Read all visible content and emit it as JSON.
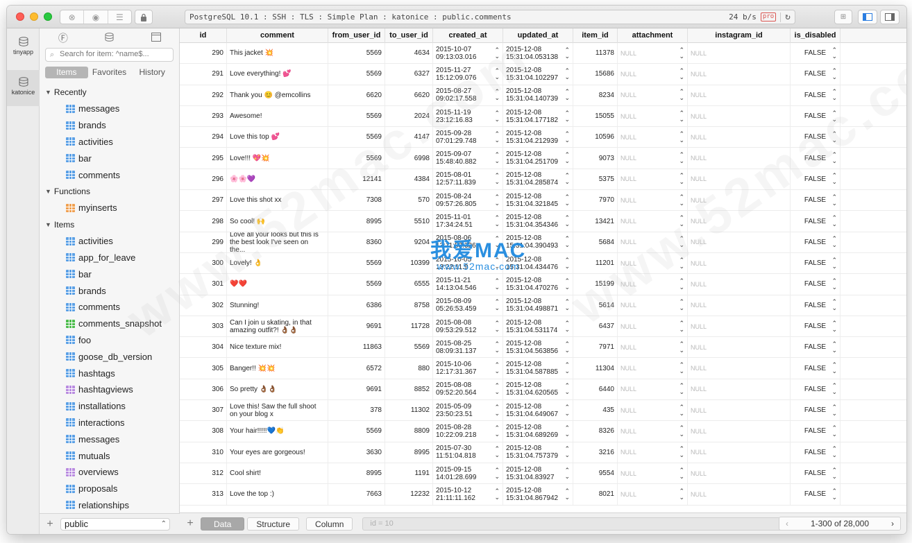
{
  "titlebar": {
    "connection": "PostgreSQL 10.1 : SSH : TLS : Simple Plan : katonice : public.comments",
    "throughput": "24 b/s",
    "pro_badge": "pro"
  },
  "rail": {
    "items": [
      "tinyapp",
      "katonice"
    ]
  },
  "sidebar": {
    "search_placeholder": "Search for item: ^name$...",
    "segments": [
      "Items",
      "Favorites",
      "History"
    ],
    "sections": [
      {
        "title": "Recently",
        "items": [
          {
            "label": "messages",
            "icon": "table-icon"
          },
          {
            "label": "brands",
            "icon": "table-icon"
          },
          {
            "label": "activities",
            "icon": "table-icon"
          },
          {
            "label": "bar",
            "icon": "table-icon"
          },
          {
            "label": "comments",
            "icon": "table-icon"
          }
        ]
      },
      {
        "title": "Functions",
        "items": [
          {
            "label": "myinserts",
            "icon": "function-icon"
          }
        ]
      },
      {
        "title": "Items",
        "items": [
          {
            "label": "activities",
            "icon": "table-icon"
          },
          {
            "label": "app_for_leave",
            "icon": "table-icon"
          },
          {
            "label": "bar",
            "icon": "table-icon"
          },
          {
            "label": "brands",
            "icon": "table-icon"
          },
          {
            "label": "comments",
            "icon": "table-icon"
          },
          {
            "label": "comments_snapshot",
            "icon": "materialized-view-icon"
          },
          {
            "label": "foo",
            "icon": "table-icon"
          },
          {
            "label": "goose_db_version",
            "icon": "table-icon"
          },
          {
            "label": "hashtags",
            "icon": "table-icon"
          },
          {
            "label": "hashtagviews",
            "icon": "view-icon"
          },
          {
            "label": "installations",
            "icon": "table-icon"
          },
          {
            "label": "interactions",
            "icon": "table-icon"
          },
          {
            "label": "messages",
            "icon": "table-icon"
          },
          {
            "label": "mutuals",
            "icon": "table-icon"
          },
          {
            "label": "overviews",
            "icon": "view-icon"
          },
          {
            "label": "proposals",
            "icon": "table-icon"
          },
          {
            "label": "relationships",
            "icon": "table-icon"
          }
        ]
      }
    ],
    "schema": "public"
  },
  "grid": {
    "columns": [
      "id",
      "comment",
      "from_user_id",
      "to_user_id",
      "created_at",
      "updated_at",
      "item_id",
      "attachment",
      "instagram_id",
      "is_disabled"
    ],
    "null_text": "NULL",
    "rows": [
      {
        "id": "290",
        "comment": "This jacket 💥",
        "from": "5569",
        "to": "4634",
        "created": "2015-10-07\n09:13:03.016",
        "updated": "2015-12-08\n15:31:04.053138",
        "item": "11378",
        "disabled": "FALSE"
      },
      {
        "id": "291",
        "comment": "Love everything! 💕",
        "from": "5569",
        "to": "6327",
        "created": "2015-11-27\n15:12:09.076",
        "updated": "2015-12-08\n15:31:04.102297",
        "item": "15686",
        "disabled": "FALSE"
      },
      {
        "id": "292",
        "comment": "Thank you 😊 @emcollins",
        "from": "6620",
        "to": "6620",
        "created": "2015-08-27\n09:02:17.558",
        "updated": "2015-12-08\n15:31:04.140739",
        "item": "8234",
        "disabled": "FALSE"
      },
      {
        "id": "293",
        "comment": "Awesome!",
        "from": "5569",
        "to": "2024",
        "created": "2015-11-19\n23:12:16.83",
        "updated": "2015-12-08\n15:31:04.177182",
        "item": "15055",
        "disabled": "FALSE"
      },
      {
        "id": "294",
        "comment": "Love this top 💕",
        "from": "5569",
        "to": "4147",
        "created": "2015-09-28\n07:01:29.748",
        "updated": "2015-12-08\n15:31:04.212939",
        "item": "10596",
        "disabled": "FALSE"
      },
      {
        "id": "295",
        "comment": "Love!!! 💖💥",
        "from": "5569",
        "to": "6998",
        "created": "2015-09-07\n15:48:40.882",
        "updated": "2015-12-08\n15:31:04.251709",
        "item": "9073",
        "disabled": "FALSE"
      },
      {
        "id": "296",
        "comment": "🌸🌸💜",
        "from": "12141",
        "to": "4384",
        "created": "2015-08-01\n12:57:11.839",
        "updated": "2015-12-08\n15:31:04.285874",
        "item": "5375",
        "disabled": "FALSE"
      },
      {
        "id": "297",
        "comment": "Love this shot xx",
        "from": "7308",
        "to": "570",
        "created": "2015-08-24\n09:57:26.805",
        "updated": "2015-12-08\n15:31:04.321845",
        "item": "7970",
        "disabled": "FALSE"
      },
      {
        "id": "298",
        "comment": "So cool! 🙌",
        "from": "8995",
        "to": "5510",
        "created": "2015-11-01\n17:34:24.51",
        "updated": "2015-12-08\n15:31:04.354346",
        "item": "13421",
        "disabled": "FALSE"
      },
      {
        "id": "299",
        "comment": "Love all your looks but this is the best look I've seen on the...",
        "from": "8360",
        "to": "9204",
        "created": "2015-08-06\n13:11:53.326",
        "updated": "2015-12-08\n15:31:04.390493",
        "item": "5684",
        "disabled": "FALSE"
      },
      {
        "id": "300",
        "comment": "Lovely! 👌",
        "from": "5569",
        "to": "10399",
        "created": "2015-10-05\n13:22:11.9",
        "updated": "2015-12-08\n15:31:04.434476",
        "item": "11201",
        "disabled": "FALSE"
      },
      {
        "id": "301",
        "comment": "❤️❤️",
        "from": "5569",
        "to": "6555",
        "created": "2015-11-21\n14:13:04.546",
        "updated": "2015-12-08\n15:31:04.470276",
        "item": "15199",
        "disabled": "FALSE"
      },
      {
        "id": "302",
        "comment": "Stunning!",
        "from": "6386",
        "to": "8758",
        "created": "2015-08-09\n05:26:53.459",
        "updated": "2015-12-08\n15:31:04.498871",
        "item": "5614",
        "disabled": "FALSE"
      },
      {
        "id": "303",
        "comment": "Can I join u skating, in that amazing outfit?! 👌🏾👌🏾",
        "from": "9691",
        "to": "11728",
        "created": "2015-08-08\n09:53:29.512",
        "updated": "2015-12-08\n15:31:04.531174",
        "item": "6437",
        "disabled": "FALSE"
      },
      {
        "id": "304",
        "comment": "Nice texture mix!",
        "from": "11863",
        "to": "5569",
        "created": "2015-08-25\n08:09:31.137",
        "updated": "2015-12-08\n15:31:04.563856",
        "item": "7971",
        "disabled": "FALSE"
      },
      {
        "id": "305",
        "comment": "Banger!! 💥💥",
        "from": "6572",
        "to": "880",
        "created": "2015-10-06\n12:17:31.367",
        "updated": "2015-12-08\n15:31:04.587885",
        "item": "11304",
        "disabled": "FALSE"
      },
      {
        "id": "306",
        "comment": "So pretty 👌🏾👌🏾",
        "from": "9691",
        "to": "8852",
        "created": "2015-08-08\n09:52:20.564",
        "updated": "2015-12-08\n15:31:04.620565",
        "item": "6440",
        "disabled": "FALSE"
      },
      {
        "id": "307",
        "comment": " Love this! Saw the full shoot on your blog x",
        "from": "378",
        "to": "11302",
        "created": "2015-05-09\n23:50:23.51",
        "updated": "2015-12-08\n15:31:04.649067",
        "item": "435",
        "disabled": "FALSE"
      },
      {
        "id": "308",
        "comment": "Your hair!!!!!💙👏",
        "from": "5569",
        "to": "8809",
        "created": "2015-08-28\n10:22:09.218",
        "updated": "2015-12-08\n15:31:04.689269",
        "item": "8326",
        "disabled": "FALSE"
      },
      {
        "id": "310",
        "comment": "Your eyes are gorgeous!",
        "from": "3630",
        "to": "8995",
        "created": "2015-07-30\n11:51:04.818",
        "updated": "2015-12-08\n15:31:04.757379",
        "item": "3216",
        "disabled": "FALSE"
      },
      {
        "id": "312",
        "comment": "Cool shirt!",
        "from": "8995",
        "to": "1191",
        "created": "2015-09-15\n14:01:28.699",
        "updated": "2015-12-08\n15:31:04.83927",
        "item": "9554",
        "disabled": "FALSE"
      },
      {
        "id": "313",
        "comment": "Love the top :)",
        "from": "7663",
        "to": "12232",
        "created": "2015-10-12\n21:11:11.162",
        "updated": "2015-12-08\n15:31:04.867942",
        "item": "8021",
        "disabled": "FALSE"
      }
    ]
  },
  "bottombar": {
    "tabs": [
      "Data",
      "Structure",
      "Column"
    ],
    "filter_placeholder": "id = 10",
    "pagination": "1-300 of 28,000"
  },
  "watermark": {
    "text": "www.52mac.com",
    "center_big": "我爱MAC",
    "center_small": "www.52mac.com"
  }
}
